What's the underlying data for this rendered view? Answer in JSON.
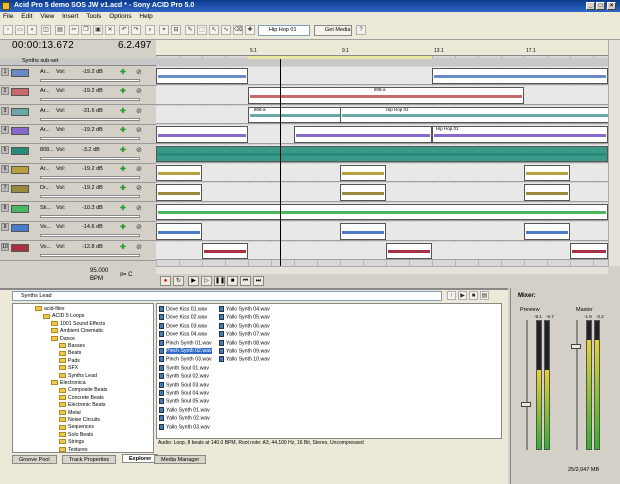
{
  "window": {
    "title": "Acid Pro 5 demo SOS JW v1.acd * - Sony ACID Pro 5.0"
  },
  "menu": [
    "File",
    "Edit",
    "View",
    "Insert",
    "Tools",
    "Options",
    "Help"
  ],
  "toolbar": {
    "selector_value": "Hip Hop 01",
    "get_media_label": "Get Media"
  },
  "time": {
    "position": "00:00:13.672",
    "beat": "6.2.497"
  },
  "ruler_labels": [
    "5.1",
    "9.1",
    "13.1",
    "17.1"
  ],
  "subset": {
    "label": "Synths sub-set"
  },
  "tracks": [
    {
      "name": "Ar...",
      "vol_label": "Vol:",
      "db": "-19.2 dB",
      "color": "#6a8ac8"
    },
    {
      "name": "Ar...",
      "vol_label": "Vol:",
      "db": "-19.2 dB",
      "color": "#c86a6a"
    },
    {
      "name": "Ar...",
      "vol_label": "Vol:",
      "db": "-31.6 dB",
      "color": "#6aa8a8"
    },
    {
      "name": "Ar...",
      "vol_label": "Vol:",
      "db": "-19.2 dB",
      "color": "#8a6ac8"
    },
    {
      "name": "808...",
      "vol_label": "Vol:",
      "db": "-3.2 dB",
      "color": "#2a8a7a"
    },
    {
      "name": "Ar...",
      "vol_label": "Vol:",
      "db": "-19.2 dB",
      "color": "#b8a040"
    },
    {
      "name": "Dr...",
      "vol_label": "Vol:",
      "db": "-19.2 dB",
      "color": "#9a8a40"
    },
    {
      "name": "Sti...",
      "vol_label": "Vol:",
      "db": "-10.3 dB",
      "color": "#4ab860"
    },
    {
      "name": "Vo...",
      "vol_label": "Vol:",
      "db": "-14.6 dB",
      "color": "#4a7ac8"
    },
    {
      "name": "Vo...",
      "vol_label": "Vol:",
      "db": "-12.8 dB",
      "color": "#a83040"
    }
  ],
  "clip_labels": {
    "c808a": "808-a",
    "hiphop": "Hip Hop 01"
  },
  "tempo": {
    "value": "95.000",
    "unit": "BPM",
    "key": "C"
  },
  "explorer": {
    "path": "Synths Lead",
    "tree": [
      {
        "label": "acid-files",
        "lvl": 2
      },
      {
        "label": "ACID 5 Loops",
        "lvl": 3
      },
      {
        "label": "1001 Sound Effects",
        "lvl": 4
      },
      {
        "label": "Ambient Cinematic",
        "lvl": 4
      },
      {
        "label": "Dance",
        "lvl": 4
      },
      {
        "label": "Basses",
        "lvl": 5
      },
      {
        "label": "Beats",
        "lvl": 5
      },
      {
        "label": "Pads",
        "lvl": 5
      },
      {
        "label": "SFX",
        "lvl": 5
      },
      {
        "label": "Synths Lead",
        "lvl": 5
      },
      {
        "label": "Electronica",
        "lvl": 4
      },
      {
        "label": "Composite Beats",
        "lvl": 5
      },
      {
        "label": "Concrete Beats",
        "lvl": 5
      },
      {
        "label": "Electronic Beats",
        "lvl": 5
      },
      {
        "label": "Metal",
        "lvl": 5
      },
      {
        "label": "Noise Circuits",
        "lvl": 5
      },
      {
        "label": "Sequences",
        "lvl": 5
      },
      {
        "label": "Solo Beats",
        "lvl": 5
      },
      {
        "label": "Strings",
        "lvl": 5
      },
      {
        "label": "Textures",
        "lvl": 5
      }
    ],
    "files_col1": [
      "Dove Kiss 01.wav",
      "Dove Kiss 02.wav",
      "Dove Kiss 03.wav",
      "Dove Kiss 04.wav",
      "Pinch Synth 01.wav",
      "Pinch Synth 02.wav",
      "Pinch Synth 03.wav",
      "Synth Soul 01.wav",
      "Synth Soul 02.wav",
      "Synth Soul 03.wav",
      "Synth Soul 04.wav",
      "Synth Soul 05.wav",
      "Yallo Synth 01.wav",
      "Yallo Synth 02.wav",
      "Yallo Synth 03.wav"
    ],
    "files_col2": [
      "Yallo Synth 04.wav",
      "Yallo Synth 05.wav",
      "Yallo Synth 06.wav",
      "Yallo Synth 07.wav",
      "Yallo Synth 08.wav",
      "Yallo Synth 09.wav",
      "Yallo Synth 10.wav"
    ],
    "status": "Audio: Loop, 8 beats at 140.0 BPM, Root note: A3, 44,100 Hz, 16 Bit, Stereo, Uncompressed",
    "tabs": [
      "Groove Pool",
      "Track Properties",
      "Explorer",
      "Media Manager"
    ],
    "active_tab": "Explorer"
  },
  "mixer": {
    "label": "Mixer:",
    "preview": "Preview",
    "master": "Master",
    "status": "25/2,047 MB",
    "preview_vals": [
      "-9.1",
      "-6.7"
    ],
    "master_vals": [
      "-1.9",
      "-2.2"
    ],
    "preview_level": 0.62,
    "master_level": 0.85
  }
}
